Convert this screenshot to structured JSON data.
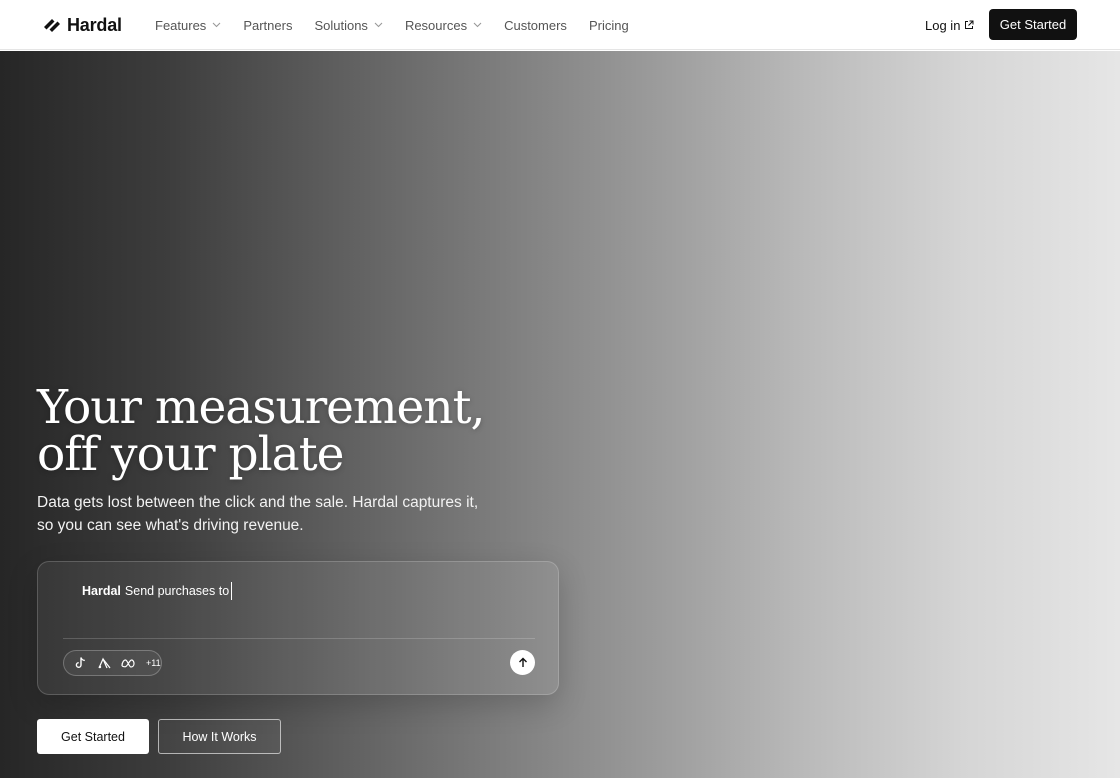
{
  "brand": {
    "name": "Hardal"
  },
  "nav": {
    "items": [
      {
        "label": "Features",
        "has_dropdown": true
      },
      {
        "label": "Partners",
        "has_dropdown": false
      },
      {
        "label": "Solutions",
        "has_dropdown": true
      },
      {
        "label": "Resources",
        "has_dropdown": true
      },
      {
        "label": "Customers",
        "has_dropdown": false
      },
      {
        "label": "Pricing",
        "has_dropdown": false
      }
    ],
    "login_label": "Log in",
    "cta_label": "Get Started"
  },
  "hero": {
    "headline_line1": "Your measurement,",
    "headline_line2": "off your plate",
    "subtext": "Data gets lost between the click and the sale. Hardal captures it, so you can see what's driving revenue.",
    "prompt": {
      "brand": "Hardal",
      "text": "Send purchases to",
      "integrations": [
        "tiktok-icon",
        "google-ads-icon",
        "meta-icon"
      ],
      "more_count": "+11"
    },
    "primary_button": "Get Started",
    "secondary_button": "How It Works"
  },
  "colors": {
    "header_bg": "#ffffff",
    "cta_bg": "#111111",
    "hero_gradient_start": "#262626",
    "hero_gradient_end": "#e6e6e6"
  }
}
